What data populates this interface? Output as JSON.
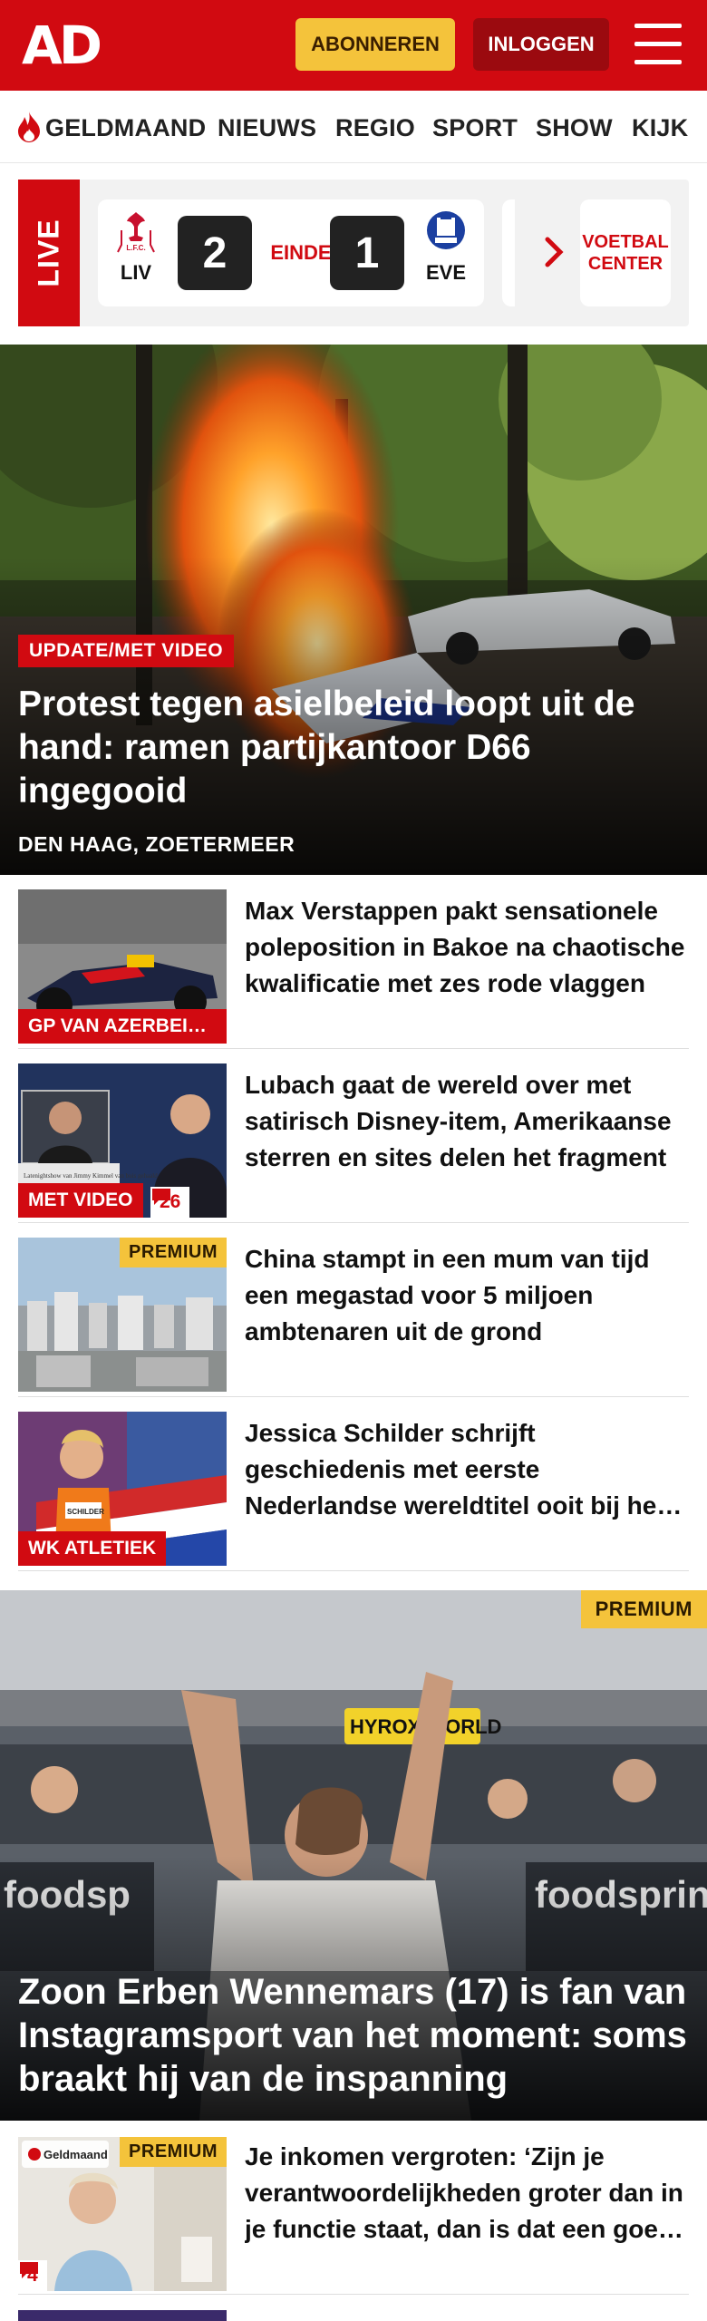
{
  "header": {
    "logo": "AD",
    "subscribe_label": "ABONNEREN",
    "login_label": "INLOGGEN",
    "brand_color": "#d10a11",
    "subscribe_color": "#f4c33b"
  },
  "nav": {
    "items": [
      {
        "label": "GELDMAAND",
        "icon": "flame-icon"
      },
      {
        "label": "NIEUWS"
      },
      {
        "label": "REGIO"
      },
      {
        "label": "SPORT"
      },
      {
        "label": "SHOW"
      },
      {
        "label": "KIJK"
      }
    ]
  },
  "live": {
    "label": "LIVE",
    "match": {
      "home": "LIV",
      "home_score": "2",
      "status": "EINDE",
      "away_score": "1",
      "away": "EVE"
    },
    "voetbal_center": "VOETBAL CENTER"
  },
  "hero": {
    "badge": "UPDATE/MET VIDEO",
    "title": "Protest tegen asielbeleid loopt uit de hand: ramen partijkantoor D66 ingegooid",
    "location": "DEN HAAG, ZOETERMEER"
  },
  "articles": [
    {
      "title": "Max Verstappen pakt sensationele poleposition in Bakoe na chaotische kwalificatie met zes rode vlaggen",
      "badge": "GP VAN AZERBEIDZJAN"
    },
    {
      "title": "Lubach gaat de wereld over met satirisch Disney-item, Amerikaanse sterren en sites delen het fragment",
      "badge": "MET VIDEO",
      "comments": "26",
      "caption": "Latenightshow van Jimmy Kimmel van buis gehaald"
    },
    {
      "title": "China stampt in een mum van tijd een megastad voor 5 miljoen ambtenaren uit de grond",
      "premium": "PREMIUM"
    },
    {
      "title": "Jessica Schilder schrijft geschiedenis met eerste Nederlandse wereldtitel ooit bij het kogelstoten",
      "badge": "WK ATLETIEK",
      "bib": "SCHILDER"
    }
  ],
  "hero2": {
    "premium": "PREMIUM",
    "title": "Zoon Erben Wennemars (17) is fan van Instagramsport van het moment: soms braakt hij van de inspanning",
    "sign": "HYROX WORLD",
    "banner_left": "foodsp",
    "banner_right": "foodsprin"
  },
  "article_more": {
    "title": "Je inkomen vergroten: ‘Zijn je verantwoordelijkheden groter dan in je functie staat, dan is dat een goed argument’",
    "premium": "PREMIUM",
    "comments": "4",
    "brand_tag": "Geldmaand"
  }
}
